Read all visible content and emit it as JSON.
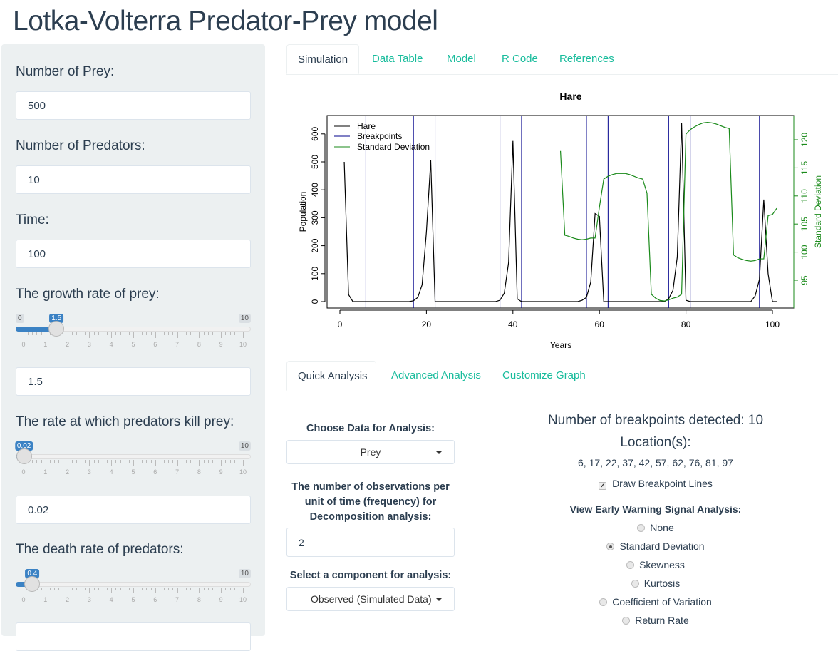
{
  "app_title": "Lotka-Volterra Predator-Prey model",
  "sidebar": {
    "prey": {
      "label": "Number of Prey:",
      "value": "500"
    },
    "predators": {
      "label": "Number of Predators:",
      "value": "10"
    },
    "time": {
      "label": "Time:",
      "value": "100"
    },
    "growth": {
      "label": "The growth rate of prey:",
      "min": "0",
      "max": "10",
      "value_label": "1.5",
      "value": 1.5,
      "input": "1.5"
    },
    "kill": {
      "label": "The rate at which predators kill prey:",
      "min": "0",
      "max": "10",
      "value_label": "0.02",
      "value": 0.02,
      "input": "0.02"
    },
    "death": {
      "label": "The death rate of predators:",
      "min": "0",
      "max": "10",
      "value_label": "0.4",
      "value": 0.4
    },
    "tick_labels": [
      "0",
      "1",
      "2",
      "3",
      "4",
      "5",
      "6",
      "7",
      "8",
      "9",
      "10"
    ]
  },
  "main_tabs": [
    {
      "label": "Simulation",
      "active": true
    },
    {
      "label": "Data Table"
    },
    {
      "label": "Model"
    },
    {
      "label": "R Code"
    },
    {
      "label": "References"
    }
  ],
  "chart_data": {
    "type": "line",
    "title": "Hare",
    "xlabel": "Years",
    "ylabel": "Population",
    "y2label": "Standard Deviation",
    "xlim": [
      0,
      105
    ],
    "ylim": [
      -40,
      650
    ],
    "y2lim": [
      91.2,
      124.3
    ],
    "xticks": [
      "0",
      "20",
      "40",
      "60",
      "80",
      "100"
    ],
    "yticks": [
      "0",
      "100",
      "200",
      "300",
      "400",
      "500",
      "600"
    ],
    "y2ticks": [
      "95",
      "100",
      "105",
      "110",
      "115",
      "120"
    ],
    "legend": {
      "position": "top-left",
      "entries": [
        "Hare",
        "Breakpoints",
        "Standard Deviation"
      ]
    },
    "colors": {
      "hare": "#000000",
      "breakpoints": "#00008b",
      "sd": "#1a8a1a"
    },
    "breakpoints": [
      6,
      17,
      22,
      37,
      42,
      57,
      62,
      76,
      81,
      97
    ],
    "hare": {
      "x_start": 1,
      "values": [
        500,
        25,
        0,
        0,
        0,
        0,
        0,
        0,
        0,
        0,
        0,
        0,
        0,
        0,
        0,
        0,
        3,
        15,
        60,
        250,
        505,
        0,
        0,
        0,
        0,
        0,
        0,
        0,
        0,
        0,
        0,
        0,
        0,
        0,
        0,
        0,
        5,
        30,
        140,
        575,
        10,
        0,
        0,
        0,
        0,
        0,
        0,
        0,
        0,
        0,
        0,
        0,
        0,
        0,
        0,
        5,
        15,
        70,
        315,
        305,
        0,
        0,
        0,
        0,
        0,
        0,
        0,
        0,
        0,
        0,
        0,
        0,
        0,
        0,
        0,
        10,
        40,
        160,
        640,
        5,
        0,
        0,
        0,
        0,
        0,
        0,
        0,
        0,
        0,
        0,
        0,
        0,
        0,
        0,
        0,
        20,
        80,
        365,
        100,
        0,
        0
      ]
    },
    "sd": {
      "x_start": 51,
      "values": [
        118,
        103,
        102.8,
        102.5,
        102.3,
        102.2,
        102.3,
        102.5,
        102.5,
        108,
        113,
        113.5,
        113.8,
        114,
        114,
        114,
        113.8,
        113.5,
        113.2,
        113,
        110.5,
        92.5,
        91.8,
        91.4,
        91.3,
        91.5,
        91.8,
        92,
        92.5,
        121,
        121.8,
        122.3,
        122.7,
        123,
        123.1,
        123,
        122.8,
        122.5,
        122.2,
        122,
        99.5,
        99,
        98.7,
        98.5,
        98.4,
        98.5,
        98.8,
        98.8,
        106.5,
        106.7,
        107.8
      ]
    }
  },
  "analysis_tabs": [
    {
      "label": "Quick Analysis",
      "active": true
    },
    {
      "label": "Advanced Analysis"
    },
    {
      "label": "Customize Graph"
    }
  ],
  "quick": {
    "data_label": "Choose Data for Analysis:",
    "data_value": "Prey",
    "freq_label_lines": [
      "The number of observations per",
      "unit of time (frequency) for",
      "Decomposition analysis:"
    ],
    "freq_value": "2",
    "component_label": "Select a component for analysis:",
    "component_value": "Observed (Simulated Data)",
    "breakpoints_text": "Number of breakpoints detected: 10",
    "locations_label": "Location(s):",
    "locations": "6, 17, 22, 37, 42, 57, 62, 76, 81, 97",
    "draw_lines_label": "Draw Breakpoint Lines",
    "draw_lines_checked": true,
    "ews_label": "View Early Warning Signal Analysis:",
    "ews_options": [
      "None",
      "Standard Deviation",
      "Skewness",
      "Kurtosis",
      "Coefficient of Variation",
      "Return Rate"
    ],
    "ews_selected": "Standard Deviation"
  }
}
